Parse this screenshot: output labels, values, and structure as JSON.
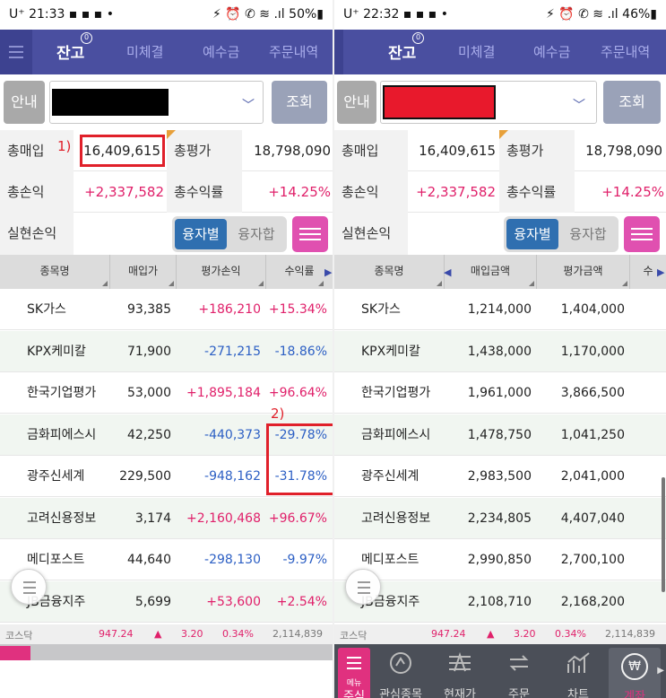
{
  "screens": [
    {
      "status": {
        "time": "21:33",
        "carrier": "U⁺",
        "right_icons": "⚡ ⏰ ✆ ≋ .ıl",
        "battery": "50%"
      },
      "tabs": [
        "잔고",
        "미체결",
        "예수금",
        "주문내역"
      ],
      "tab_badge": "0",
      "guide_button": "안내",
      "query_button": "조회",
      "summary": {
        "buy_total_label": "총매입",
        "buy_total": "16,409,615",
        "eval_total_label": "총평가",
        "eval_total": "18,798,090",
        "pl_label": "총손익",
        "pl": "+2,337,582",
        "rate_label": "총수익률",
        "rate": "+14.25%",
        "realized_label": "실현손익"
      },
      "toggle": {
        "on": "융자별",
        "off": "융자합"
      },
      "columns": [
        "종목명",
        "매입가",
        "평가손익",
        "수익률"
      ],
      "rows": [
        {
          "name": "SK가스",
          "a": "93,385",
          "b": "+186,210",
          "c": "+15.34%",
          "bc": "red",
          "cc": "red"
        },
        {
          "name": "KPX케미칼",
          "a": "71,900",
          "b": "-271,215",
          "c": "-18.86%",
          "bc": "blue",
          "cc": "blue"
        },
        {
          "name": "한국기업평가",
          "a": "53,000",
          "b": "+1,895,184",
          "c": "+96.64%",
          "bc": "red",
          "cc": "red"
        },
        {
          "name": "금화피에스시",
          "a": "42,250",
          "b": "-440,373",
          "c": "-29.78%",
          "bc": "blue",
          "cc": "blue"
        },
        {
          "name": "광주신세계",
          "a": "229,500",
          "b": "-948,162",
          "c": "-31.78%",
          "bc": "blue",
          "cc": "blue"
        },
        {
          "name": "고려신용정보",
          "a": "3,174",
          "b": "+2,160,468",
          "c": "+96.67%",
          "bc": "red",
          "cc": "red"
        },
        {
          "name": "메디포스트",
          "a": "44,640",
          "b": "-298,130",
          "c": "-9.97%",
          "bc": "blue",
          "cc": "blue"
        },
        {
          "name": "JB금융지주",
          "a": "5,699",
          "b": "+53,600",
          "c": "+2.54%",
          "bc": "red",
          "cc": "red"
        }
      ],
      "ticker": {
        "index": "코스닥",
        "value": "947.24",
        "arrow": "▲",
        "change": "3.20",
        "pct": "0.34%",
        "volume": "2,114,839"
      },
      "annotations": [
        "1)",
        "2)"
      ]
    },
    {
      "status": {
        "time": "22:32",
        "carrier": "U⁺",
        "right_icons": "⚡ ⏰ ✆ ≋ .ıl",
        "battery": "46%"
      },
      "tabs": [
        "잔고",
        "미체결",
        "예수금",
        "주문내역"
      ],
      "tab_badge": "0",
      "guide_button": "안내",
      "query_button": "조회",
      "summary": {
        "buy_total_label": "총매입",
        "buy_total": "16,409,615",
        "eval_total_label": "총평가",
        "eval_total": "18,798,090",
        "pl_label": "총손익",
        "pl": "+2,337,582",
        "rate_label": "총수익률",
        "rate": "+14.25%",
        "realized_label": "실현손익"
      },
      "toggle": {
        "on": "융자별",
        "off": "융자합"
      },
      "columns": [
        "종목명",
        "매입금액",
        "평가금액",
        "수"
      ],
      "rows": [
        {
          "name": "SK가스",
          "a": "1,214,000",
          "b": "1,404,000",
          "bc": "dark"
        },
        {
          "name": "KPX케미칼",
          "a": "1,438,000",
          "b": "1,170,000",
          "bc": "dark"
        },
        {
          "name": "한국기업평가",
          "a": "1,961,000",
          "b": "3,866,500",
          "bc": "dark"
        },
        {
          "name": "금화피에스시",
          "a": "1,478,750",
          "b": "1,041,250",
          "bc": "dark"
        },
        {
          "name": "광주신세계",
          "a": "2,983,500",
          "b": "2,041,000",
          "bc": "dark"
        },
        {
          "name": "고려신용정보",
          "a": "2,234,805",
          "b": "4,407,040",
          "bc": "dark"
        },
        {
          "name": "메디포스트",
          "a": "2,990,850",
          "b": "2,700,100",
          "bc": "dark"
        },
        {
          "name": "JB금융지주",
          "a": "2,108,710",
          "b": "2,168,200",
          "bc": "dark"
        }
      ],
      "ticker": {
        "index": "코스닥",
        "value": "947.24",
        "arrow": "▲",
        "change": "3.20",
        "pct": "0.34%",
        "volume": "2,114,839"
      },
      "nav": {
        "menu": "메뉴",
        "items": [
          "주식",
          "관심종목",
          "현재가",
          "주문",
          "차트",
          "계좌"
        ]
      },
      "colors": {
        "tab_bar": "#4a4fa0",
        "positive": "#e0206a",
        "negative": "#2c5fc4",
        "annotation": "#e0202a"
      }
    }
  ]
}
